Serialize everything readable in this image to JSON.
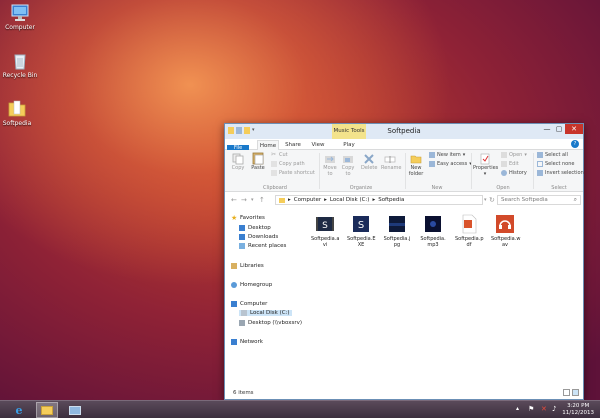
{
  "desktop": {
    "icons": [
      {
        "label": "Computer",
        "icon": "computer-icon"
      },
      {
        "label": "Recycle Bin",
        "icon": "recycle-bin-icon"
      },
      {
        "label": "Softpedia",
        "icon": "folder-icon"
      }
    ]
  },
  "window": {
    "title": "Softpedia",
    "context_tab": "Music Tools",
    "controls": {
      "minimize": "—",
      "maximize": "▢",
      "close": "✕"
    },
    "ribbon_tabs": [
      "File",
      "Home",
      "Share",
      "View",
      "Play"
    ],
    "ribbon": {
      "clipboard": {
        "copy": "Copy",
        "paste": "Paste",
        "cut": "Cut",
        "copy_path": "Copy path",
        "paste_shortcut": "Paste shortcut",
        "group": "Clipboard"
      },
      "organize": {
        "move_to_1": "Move",
        "move_to_2": "to",
        "copy_to_1": "Copy",
        "copy_to_2": "to",
        "delete": "Delete",
        "rename": "Rename",
        "group": "Organize"
      },
      "new": {
        "new_folder_1": "New",
        "new_folder_2": "folder",
        "new_item": "New item",
        "easy_access": "Easy access",
        "group": "New"
      },
      "open": {
        "properties": "Properties",
        "open": "Open",
        "edit": "Edit",
        "history": "History",
        "group": "Open"
      },
      "select": {
        "select_all": "Select all",
        "select_none": "Select none",
        "invert_selection": "Invert selection",
        "group": "Select"
      }
    },
    "address": {
      "crumbs": [
        "Computer",
        "Local Disk (C:)",
        "Softpedia"
      ],
      "separator": "▸",
      "search_placeholder": "Search Softpedia"
    },
    "nav": {
      "favorites": "Favorites",
      "desktop": "Desktop",
      "downloads": "Downloads",
      "recent": "Recent places",
      "libraries": "Libraries",
      "homegroup": "Homegroup",
      "computer": "Computer",
      "local_disk": "Local Disk (C:)",
      "network_drive": "Desktop (\\\\vboxsrv)",
      "network": "Network"
    },
    "files": [
      {
        "line1": "Softpedia.a",
        "line2": "vi",
        "icon": "video-file-icon"
      },
      {
        "line1": "Softpedia.E",
        "line2": "XE",
        "icon": "exe-file-icon"
      },
      {
        "line1": "Softpedia.j",
        "line2": "pg",
        "icon": "image-file-icon"
      },
      {
        "line1": "Softpedia.",
        "line2": "mp3",
        "icon": "audio-file-icon"
      },
      {
        "line1": "Softpedia.p",
        "line2": "df",
        "icon": "pdf-file-icon"
      },
      {
        "line1": "Softpedia.w",
        "line2": "av",
        "icon": "wav-file-icon"
      }
    ],
    "status": "6 items"
  },
  "taskbar": {
    "time": "3:20 PM",
    "date": "11/12/2013"
  },
  "colors": {
    "accent": "#1979ca",
    "context_tab": "#f3e38b",
    "close_button": "#c7342a"
  }
}
